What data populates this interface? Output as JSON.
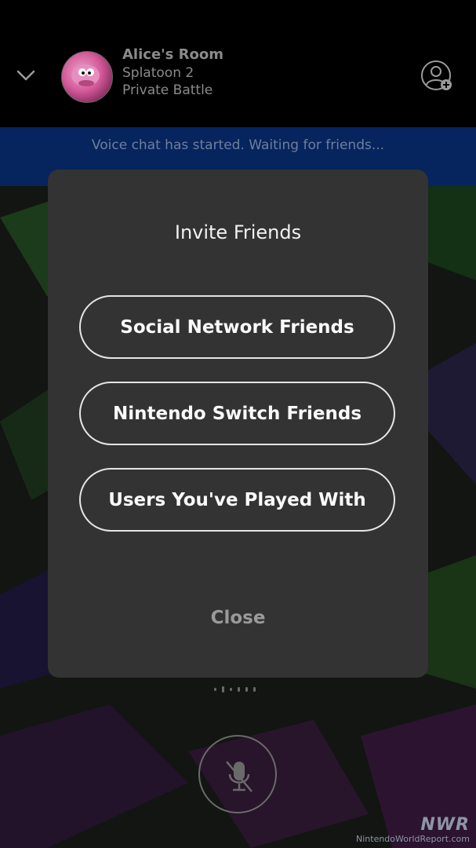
{
  "header": {
    "room_title": "Alice's Room",
    "game": "Splatoon 2",
    "mode": "Private Battle"
  },
  "banner": {
    "text": "Voice chat has started. Waiting for friends..."
  },
  "modal": {
    "title": "Invite Friends",
    "options": [
      {
        "label": "Social Network Friends"
      },
      {
        "label": "Nintendo Switch Friends"
      },
      {
        "label": "Users You've Played With"
      }
    ],
    "close_label": "Close"
  },
  "watermark": {
    "logo": "NWR",
    "url": "NintendoWorldReport.com"
  },
  "icons": {
    "collapse": "chevron-down-icon",
    "add_user": "add-user-icon",
    "mic": "microphone-muted-icon"
  },
  "colors": {
    "banner_bg": "#06245e",
    "modal_bg": "#333333"
  }
}
